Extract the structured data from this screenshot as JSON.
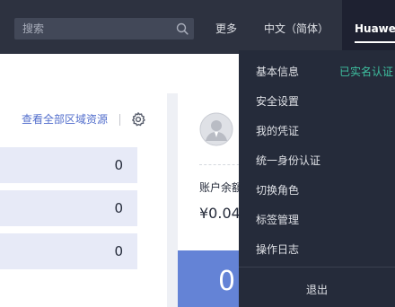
{
  "topbar": {
    "search": {
      "placeholder": "搜索",
      "value": ""
    },
    "more_label": "更多",
    "language_label": "中文（简体）",
    "user_name": "Huawei_"
  },
  "main": {
    "region_link": "查看全部区域资源",
    "stats": [
      "0",
      "0",
      "0"
    ],
    "account": {
      "balance_label": "账户余額",
      "balance_value": "¥0.04",
      "big_value": "0"
    }
  },
  "dropdown": {
    "items": [
      "基本信息",
      "安全设置",
      "我的凭证",
      "统一身份认证",
      "切换角色",
      "标签管理",
      "操作日志"
    ],
    "verified_badge": "已实名认证",
    "logout_label": "退出"
  },
  "colors": {
    "topbar_bg": "#2d3240",
    "menu_bg": "#252b3a",
    "link": "#526ecc",
    "verified": "#3ec0a0",
    "accent_block": "#6483d6",
    "stat_row_bg": "#e7eaf7"
  }
}
